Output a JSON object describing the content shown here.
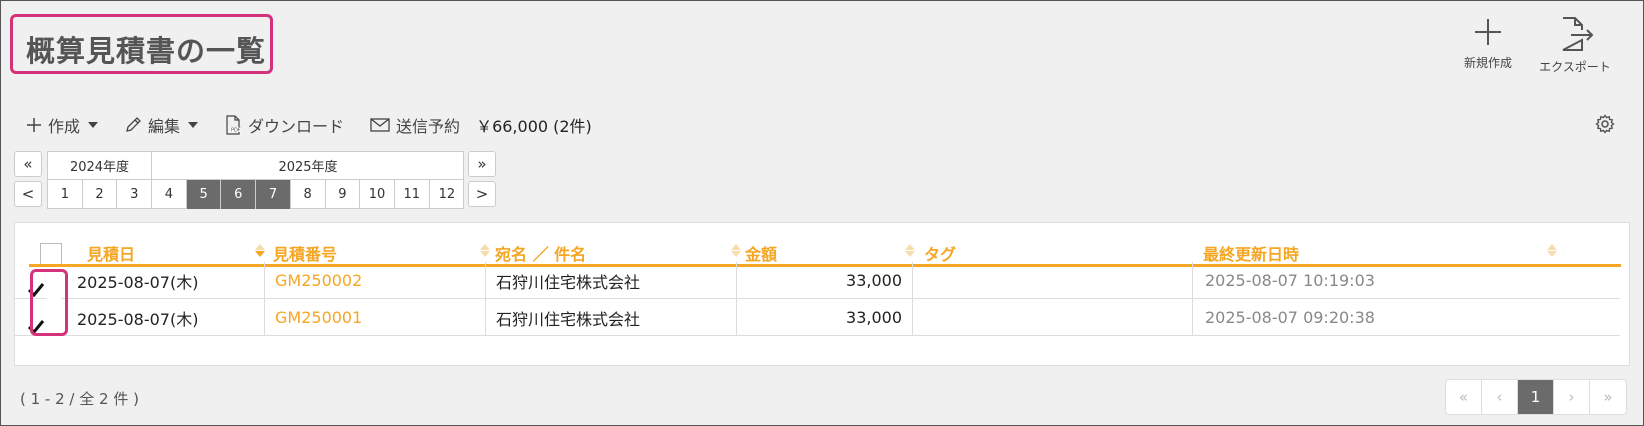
{
  "page_title": "概算見積書の一覧",
  "top_actions": {
    "new_label": "新規作成",
    "export_label": "エクスポート"
  },
  "toolbar": {
    "create_label": "作成",
    "edit_label": "編集",
    "download_label": "ダウンロード",
    "schedule_send_label": "送信予約",
    "total": "￥66,000 (2件)"
  },
  "period": {
    "prev_year": "«",
    "next_year": "»",
    "prev_month": "<",
    "next_month": ">",
    "year_2024": "2024年度",
    "year_2025": "2025年度",
    "months": [
      {
        "label": "1",
        "selected": false
      },
      {
        "label": "2",
        "selected": false
      },
      {
        "label": "3",
        "selected": false
      },
      {
        "label": "4",
        "selected": false
      },
      {
        "label": "5",
        "selected": true
      },
      {
        "label": "6",
        "selected": true
      },
      {
        "label": "7",
        "selected": true
      },
      {
        "label": "8",
        "selected": false
      },
      {
        "label": "9",
        "selected": false
      },
      {
        "label": "10",
        "selected": false
      },
      {
        "label": "11",
        "selected": false
      },
      {
        "label": "12",
        "selected": false
      }
    ]
  },
  "table": {
    "columns": [
      "見積日",
      "見積番号",
      "宛名 ／ 件名",
      "金額",
      "タグ",
      "最終更新日時"
    ],
    "rows": [
      {
        "checked": true,
        "date": "2025-08-07(木)",
        "number": "GM250002",
        "dest": "石狩川住宅株式会社",
        "amount": "33,000",
        "tag": "",
        "updated": "2025-08-07 10:19:03"
      },
      {
        "checked": true,
        "date": "2025-08-07(木)",
        "number": "GM250001",
        "dest": "石狩川住宅株式会社",
        "amount": "33,000",
        "tag": "",
        "updated": "2025-08-07 09:20:38"
      }
    ]
  },
  "footer": {
    "count": "( 1 - 2 / 全 2 件 )",
    "pager": {
      "first": "«",
      "prev": "‹",
      "current": "1",
      "next": "›",
      "last": "»"
    }
  },
  "colors": {
    "accent": "#f5a623",
    "highlight": "#d4327a",
    "selected": "#6b6b6b"
  }
}
